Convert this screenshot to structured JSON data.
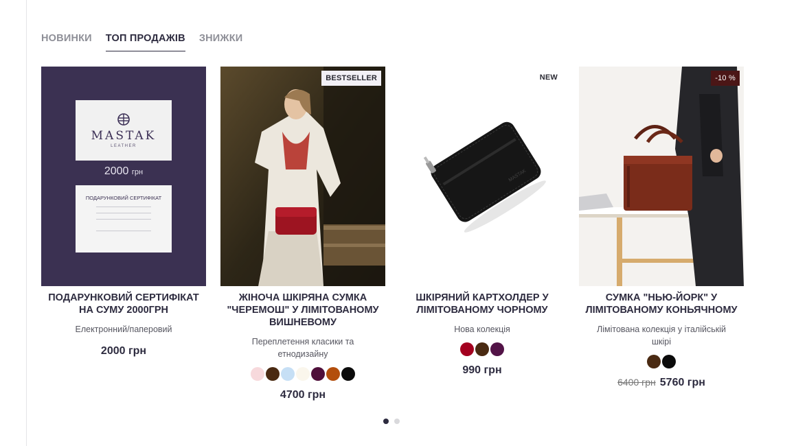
{
  "tabs": [
    {
      "label": "НОВИНКИ",
      "active": false
    },
    {
      "label": "ТОП ПРОДАЖІВ",
      "active": true
    },
    {
      "label": "ЗНИЖКИ",
      "active": false
    }
  ],
  "products": [
    {
      "title": "ПОДАРУНКОВИЙ СЕРТИФІКАТ НА СУМУ 2000ГРН",
      "subtitle": "Електронний/паперовий",
      "price": "2000 грн",
      "image": {
        "brand": "MASTAK",
        "brand_sub": "LEATHER",
        "amount": "2000",
        "amount_unit": "грн",
        "cert_title": "ПОДАРУНКОВИЙ СЕРТИФІКАТ"
      }
    },
    {
      "badge": "BESTSELLER",
      "title": "ЖІНОЧА ШКІРЯНА СУМКА \"ЧЕРЕМОШ\" У ЛІМІТОВАНОМУ ВИШНЕВОМУ",
      "subtitle": "Переплетення класики та етнодизайну",
      "swatches": [
        "#f7d9dc",
        "#4a2a12",
        "#c6dff5",
        "#faf6ec",
        "#4f0f3a",
        "#b34e0c",
        "#0b0b0b"
      ],
      "price": "4700 грн"
    },
    {
      "badge": "NEW",
      "title": "ШКІРЯНИЙ КАРТХОЛДЕР У ЛІМІТОВАНОМУ ЧОРНОМУ",
      "subtitle": "Нова колекція",
      "swatches": [
        "#a3001f",
        "#4a2a12",
        "#521347"
      ],
      "price": "990 грн"
    },
    {
      "badge": "-10 %",
      "title": "СУМКА \"НЬЮ-ЙОРК\" У ЛІМІТОВАНОМУ КОНЬЯЧНОМУ",
      "subtitle": "Лімітована колекція у італійській шкірі",
      "swatches": [
        "#4a2a12",
        "#0b0b0b"
      ],
      "old_price": "6400 грн",
      "price": "5760 грн"
    }
  ],
  "pagination": {
    "pages": 2,
    "current": 1
  }
}
